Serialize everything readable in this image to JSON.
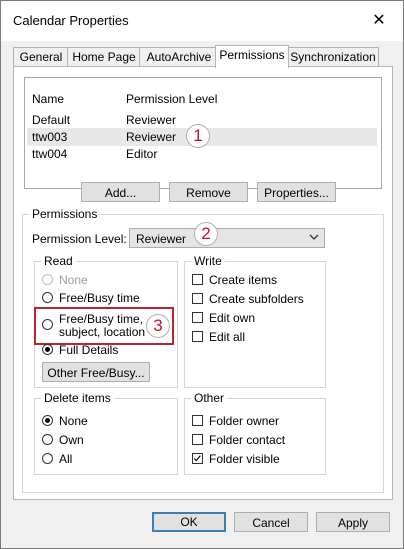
{
  "window": {
    "title": "Calendar Properties",
    "close_glyph": "✕"
  },
  "tabs": [
    {
      "label": "General"
    },
    {
      "label": "Home Page"
    },
    {
      "label": "AutoArchive"
    },
    {
      "label": "Permissions",
      "active": true
    },
    {
      "label": "Synchronization"
    }
  ],
  "permission_list": {
    "headers": {
      "name": "Name",
      "level": "Permission Level"
    },
    "rows": [
      {
        "name": "Default",
        "level": "Reviewer"
      },
      {
        "name": "ttw003",
        "level": "Reviewer",
        "selected": true
      },
      {
        "name": "ttw004",
        "level": "Editor"
      }
    ]
  },
  "list_buttons": {
    "add": "Add...",
    "remove": "Remove",
    "properties": "Properties..."
  },
  "permissions": {
    "group_label": "Permissions",
    "level_label": "Permission Level:",
    "level_value": "Reviewer",
    "read": {
      "label": "Read",
      "options": [
        {
          "label": "None",
          "disabled": true,
          "selected": false
        },
        {
          "label": "Free/Busy time",
          "selected": false
        },
        {
          "label_line1": "Free/Busy time,",
          "label_line2": "subject, location",
          "selected": false
        },
        {
          "label": "Full Details",
          "selected": true
        }
      ],
      "other_button": "Other Free/Busy..."
    },
    "write": {
      "label": "Write",
      "options": [
        {
          "label": "Create items",
          "checked": false
        },
        {
          "label": "Create subfolders",
          "checked": false
        },
        {
          "label": "Edit own",
          "checked": false
        },
        {
          "label": "Edit all",
          "checked": false
        }
      ]
    },
    "delete": {
      "label": "Delete items",
      "options": [
        {
          "label": "None",
          "selected": true
        },
        {
          "label": "Own",
          "selected": false
        },
        {
          "label": "All",
          "selected": false
        }
      ]
    },
    "other": {
      "label": "Other",
      "options": [
        {
          "label": "Folder owner",
          "checked": false
        },
        {
          "label": "Folder contact",
          "checked": false
        },
        {
          "label": "Folder visible",
          "checked": true
        }
      ]
    }
  },
  "annotations": {
    "one": "1",
    "two": "2",
    "three": "3",
    "color": "#c8102e"
  },
  "footer": {
    "ok": "OK",
    "cancel": "Cancel",
    "apply": "Apply"
  }
}
